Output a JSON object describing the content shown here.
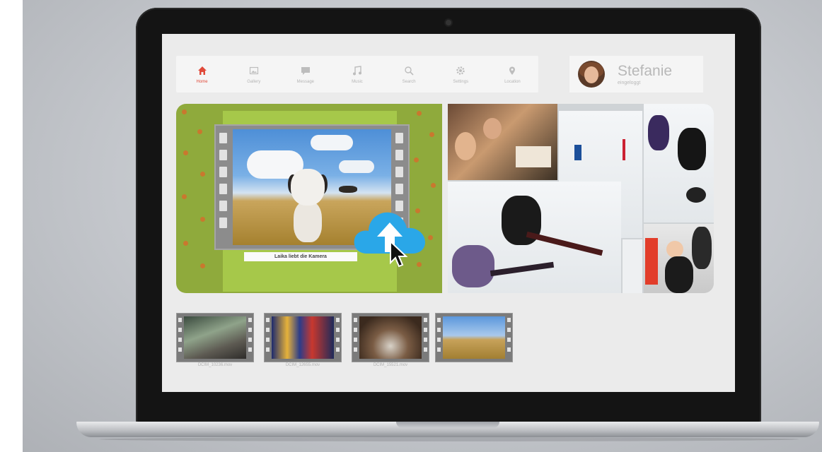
{
  "nav": {
    "items": [
      {
        "label": "Home",
        "icon": "home-icon",
        "active": true
      },
      {
        "label": "Gallery",
        "icon": "gallery-icon",
        "active": false
      },
      {
        "label": "Message",
        "icon": "message-icon",
        "active": false
      },
      {
        "label": "Music",
        "icon": "music-icon",
        "active": false
      },
      {
        "label": "Search",
        "icon": "search-icon",
        "active": false
      },
      {
        "label": "Settings",
        "icon": "gear-icon",
        "active": false
      },
      {
        "label": "Location",
        "icon": "location-icon",
        "active": false
      }
    ],
    "active_color": "#e04a3a",
    "inactive_color": "#b5b5b5"
  },
  "profile": {
    "name": "Stefanie",
    "status": "eingeloggt"
  },
  "upload": {
    "caption": "Laika liebt die Kamera"
  },
  "thumbnails": [
    {
      "filename": "DCIM_10236.mov"
    },
    {
      "filename": "DCIM_12655.mov"
    },
    {
      "filename": "DCIM_15521.mov"
    },
    {
      "filename": ""
    }
  ],
  "colors": {
    "upload_cloud": "#2aa7e8",
    "panel_green": "#8faa3c"
  }
}
